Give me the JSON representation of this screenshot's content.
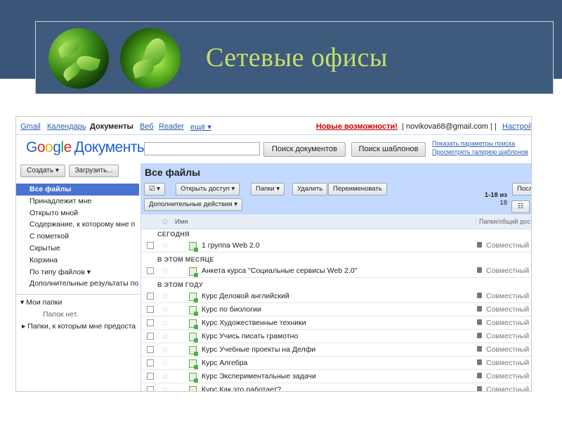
{
  "slide": {
    "title": "Сетевые офисы"
  },
  "gbar": {
    "links": [
      "Gmail",
      "Календарь",
      "Документы",
      "Веб",
      "Reader",
      "ещё ▾"
    ],
    "new_features": "Новые возможности!",
    "user": "| novikova68@gmail.com | |",
    "settings": "Настрой"
  },
  "logo": {
    "google": [
      "G",
      "o",
      "o",
      "g",
      "l",
      "e"
    ],
    "product": "Документы"
  },
  "search": {
    "value": "",
    "search_docs_button": "Поиск документов",
    "search_templates_button": "Поиск шаблонов",
    "show_options_link": "Показать параметры поиска",
    "template_gallery_link": "Просмотреть галерею шаблонов"
  },
  "sidebar": {
    "create_button": "Создать ▾",
    "upload_button": "Загрузить...",
    "items": [
      {
        "label": "Все файлы",
        "active": true
      },
      {
        "label": "Принадлежит мне"
      },
      {
        "label": "Открыто мной"
      },
      {
        "label": "Содержание, к которому мне п"
      },
      {
        "label": "С пометкой"
      },
      {
        "label": "Скрытые"
      },
      {
        "label": "Корзина"
      },
      {
        "label": "По типу файлов ▾"
      },
      {
        "label": "Дополнительные результаты по"
      }
    ],
    "my_folders": "▾ Мои папки",
    "no_folders": "Папок нет.",
    "shared_folders": "▸ Папки, к которым мне предоста"
  },
  "main": {
    "title": "Все файлы",
    "toolbar": {
      "select_button": "☑ ▾",
      "share_button": "Открыть доступ ▾",
      "folders_button": "Папки ▾",
      "delete_button": "Удалить",
      "rename_button": "Переименовать",
      "more_actions_button": "Дополнительные действия ▾",
      "range": "1-18 из",
      "total": "18",
      "sort_button": "Последнее",
      "view_button": "☷"
    },
    "columns": {
      "name": "Имя",
      "folder_sharing": "Папки/общий досту"
    },
    "sections": [
      {
        "label": "СЕГОДНЯ"
      },
      {
        "label": "В ЭТОМ МЕСЯЦЕ"
      },
      {
        "label": "В ЭТОМ ГОДУ"
      }
    ],
    "rows": [
      {
        "name": "1 группа Web 2.0",
        "sharing": "Совместный"
      },
      {
        "name": "Анкета курса \"Социальные сервисы Web 2.0\"",
        "sharing": "Совместный"
      },
      {
        "name": "Курс Деловой английский",
        "sharing": "Совместный"
      },
      {
        "name": "Курс по биологии",
        "sharing": "Совместный"
      },
      {
        "name": "Курс Художественные техники",
        "sharing": "Совместный"
      },
      {
        "name": "Курс Учись писать грамотно",
        "sharing": "Совместный"
      },
      {
        "name": "Курс Учебные проекты на Делфи",
        "sharing": "Совместный"
      },
      {
        "name": "Курс Алгебра",
        "sharing": "Совместный"
      },
      {
        "name": "Курс Экспериментальные задачи",
        "sharing": "Совместный"
      },
      {
        "name": "Курс Как это работает?",
        "sharing": "Совместный"
      }
    ]
  },
  "colors": {
    "band": "#3b5679",
    "title": "#c6e06a",
    "active_nav": "#4a73d1",
    "header_blue": "#c3d9ff"
  }
}
